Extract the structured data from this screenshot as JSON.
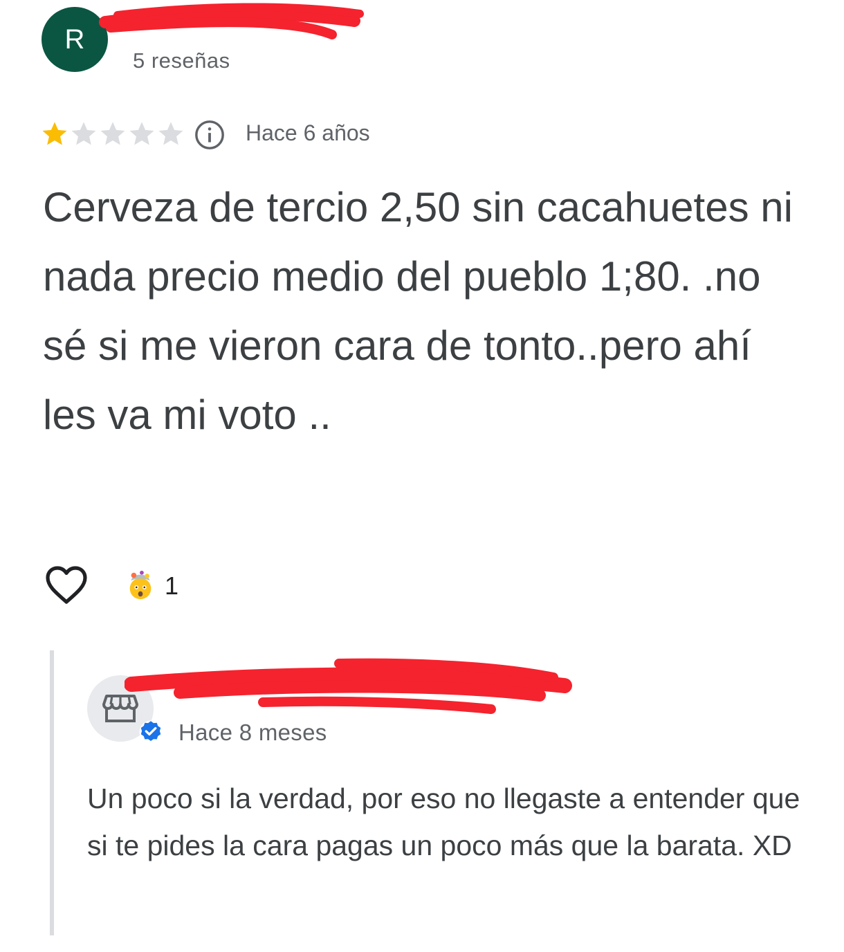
{
  "reviewer": {
    "avatar_letter": "R",
    "review_count": "5 reseñas"
  },
  "review": {
    "rating": 1,
    "max_rating": 5,
    "time_ago": "Hace 6 años",
    "text": "Cerveza de tercio 2,50 sin cacahuetes ni nada precio medio del pueblo 1;80. .no sé si me vieron cara de tonto..pero ahí les va mi voto ..",
    "reaction_count": "1"
  },
  "owner_reply": {
    "time_ago": "Hace 8 meses",
    "text": "Un poco si la verdad, por eso no llegaste a entender que si te pides la cara pagas un poco más que la barata. XD"
  },
  "colors": {
    "avatar_bg": "#0b5643",
    "star_filled": "#fbbc04",
    "star_empty": "#dadce0",
    "verified": "#1a73e8",
    "redaction": "#f4232e"
  },
  "icons": {
    "info": "info-icon",
    "like": "heart-icon",
    "reaction": "exploding-head-icon",
    "store": "storefront-icon",
    "verified": "verified-badge-icon"
  }
}
